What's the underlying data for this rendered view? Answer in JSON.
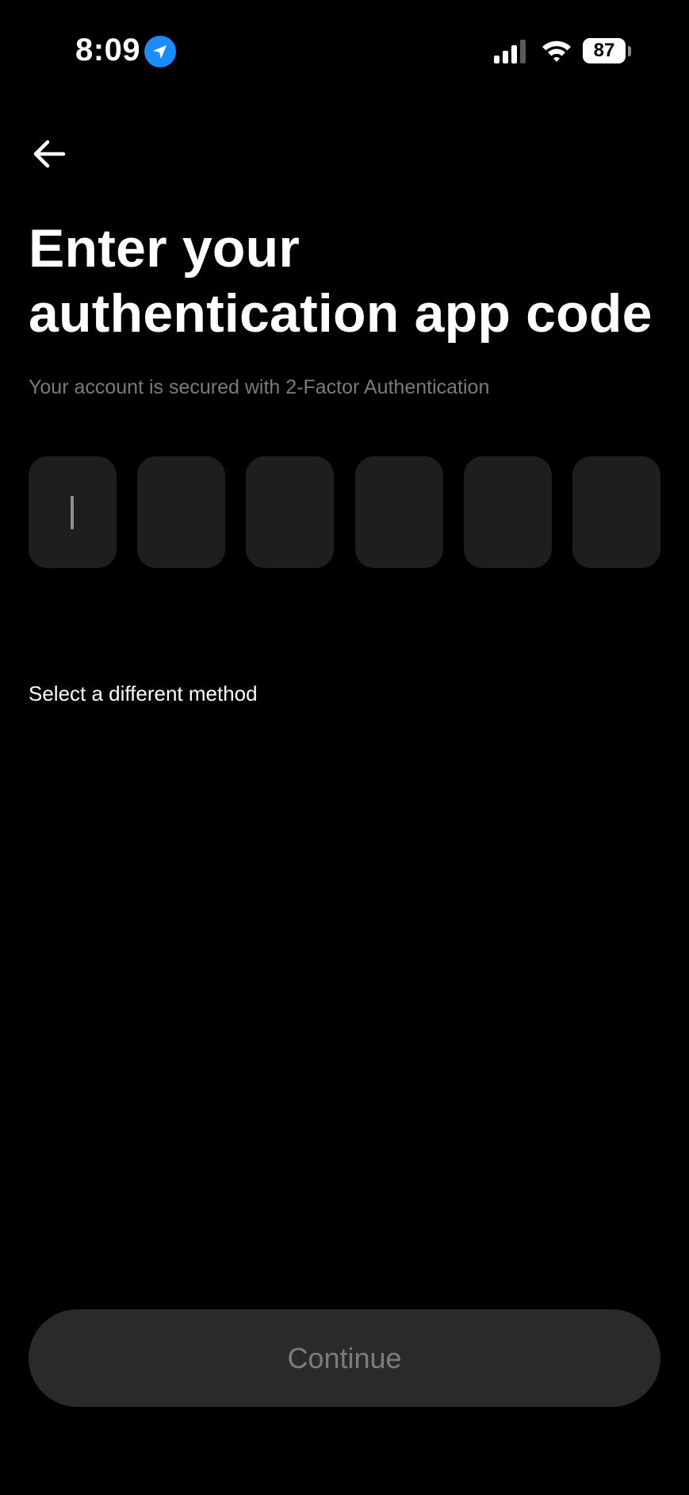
{
  "status_bar": {
    "time": "8:09",
    "battery_level": "87",
    "icons": [
      "location-arrow-icon",
      "cellular-signal-icon",
      "wifi-icon",
      "battery-icon"
    ]
  },
  "header": {
    "back_icon": "arrow-left-icon"
  },
  "main": {
    "title": "Enter your authentication app code",
    "subtitle": "Your account is secured with 2-Factor Authentication",
    "code_inputs": [
      "",
      "",
      "",
      "",
      "",
      ""
    ],
    "different_method_label": "Select a different method"
  },
  "footer": {
    "continue_label": "Continue"
  },
  "colors": {
    "background": "#000000",
    "input_background": "#1e1e20",
    "button_disabled_background": "#2a2a2a",
    "button_disabled_text": "#7c7c7c",
    "subtitle_text": "#7a7a7a",
    "location_accent": "#1a8cff"
  }
}
